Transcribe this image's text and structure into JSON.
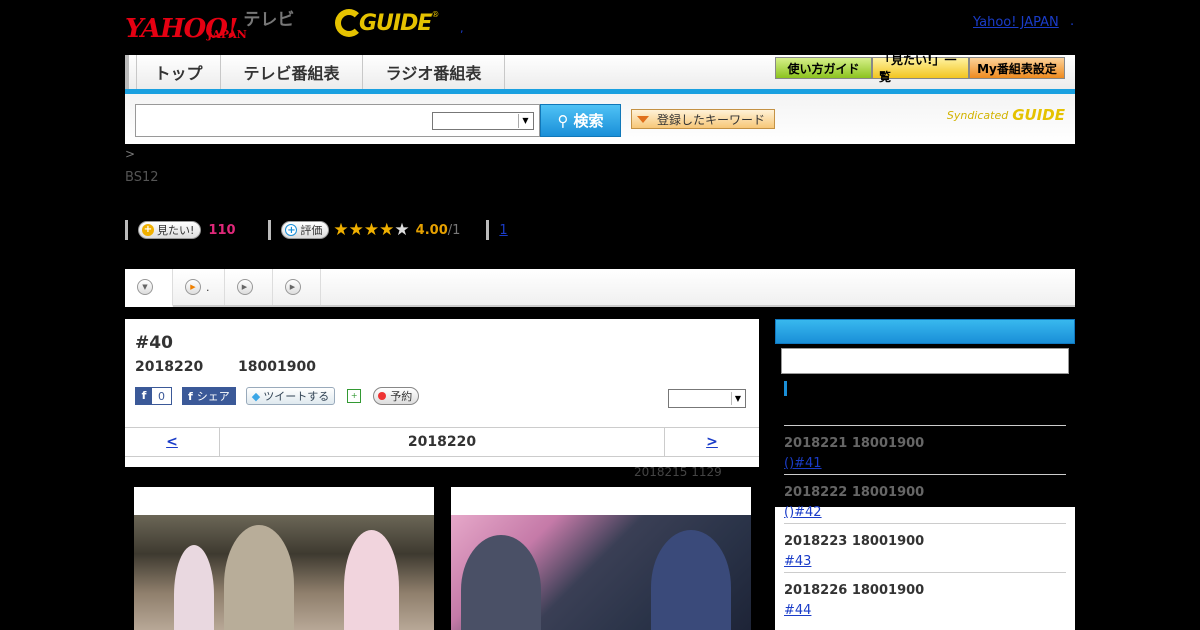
{
  "header": {
    "logo_main": "YAHOO!",
    "logo_sub": "JAPAN",
    "logo_tv": "テレビ",
    "gguide_text": "GUIDE",
    "gguide_reg": "®",
    "yahoo_japan_link": "Yahoo! JAPAN",
    "dot_after": ".",
    "mid_dot": ","
  },
  "nav": {
    "tabs": [
      {
        "label": "トップ"
      },
      {
        "label": "テレビ番組表"
      },
      {
        "label": "ラジオ番組表"
      }
    ],
    "util_buttons": [
      {
        "label": "使い方ガイド",
        "color": "#a4d43a"
      },
      {
        "label": "「見たい!」一覧",
        "color": "#f6d33b"
      },
      {
        "label": "My番組表設定",
        "color": "#f29a2e"
      }
    ],
    "accent": "#19a0e0"
  },
  "search": {
    "input_value": "",
    "select_value": "",
    "button_label": "検索",
    "keyword_label": "登録したキーワード",
    "syndicated": "Syndicated",
    "synd_logo": "GUIDE"
  },
  "breadcrumb": "> ",
  "channel": "BS12",
  "ratings": {
    "mitai_label": "見たい!",
    "mitai_count": "110",
    "hyoka_label": "評価",
    "stars_on": 4,
    "stars_total": 5,
    "rating_value": "4.00",
    "rating_count": "/1",
    "review_link": "1"
  },
  "program_tabs": [
    {
      "label": "",
      "icon": "down-circle-icon"
    },
    {
      "label": ".",
      "icon": "play-circle-icon"
    },
    {
      "label": "",
      "icon": "play-circle-icon"
    },
    {
      "label": "",
      "icon": "play-circle-icon"
    }
  ],
  "program": {
    "episode": "#40",
    "date": "2018220",
    "time": "18001900",
    "fb_count": "0",
    "fb_share": "シェア",
    "tweet": "ツイートする",
    "reserve": "予約",
    "select_value": "",
    "prev": "<",
    "current_date": "2018220",
    "next": ">",
    "updated": "2018215  1129"
  },
  "sidebar": {
    "input_value": "",
    "items": [
      {
        "date": "2018221  18001900",
        "link": "()#41"
      },
      {
        "date": "2018222  18001900",
        "link": "()#42"
      },
      {
        "date": "2018223  18001900",
        "link": "#43"
      },
      {
        "date": "2018226  18001900",
        "link": "#44"
      }
    ]
  }
}
